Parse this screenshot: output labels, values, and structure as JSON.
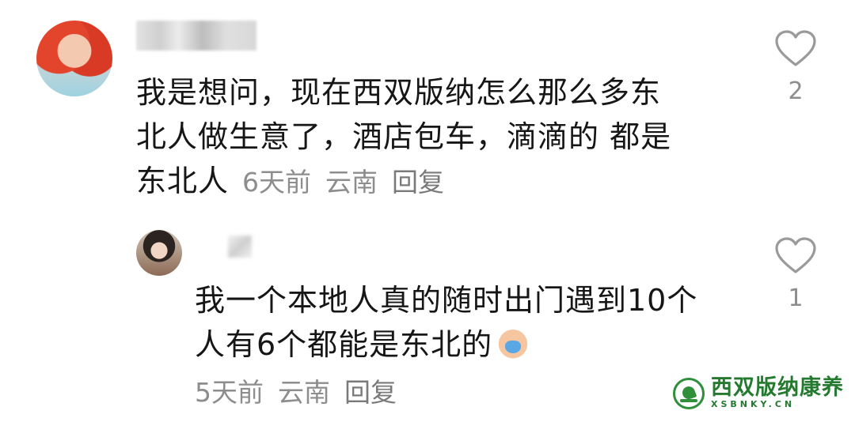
{
  "comments": [
    {
      "text": "我是想问，现在西双版纳怎么那么多东\n北人做生意了，酒店包车，滴滴的 都是\n东北人",
      "time": "6天前",
      "location": "云南",
      "reply_label": "回复",
      "likes": "2"
    },
    {
      "text": "我一个本地人真的随时出门遇到10个\n人有6个都能是东北的",
      "time": "5天前",
      "location": "云南",
      "reply_label": "回复",
      "likes": "1"
    }
  ],
  "watermark": {
    "title": "西双版纳康养",
    "subtitle": "XSBNKY.CN"
  },
  "colors": {
    "text": "#161616",
    "meta": "#8d8d8d",
    "brand": "#247a2f"
  },
  "icons": [
    "heart-icon",
    "crying-emoji-icon",
    "palm-tree-logo-icon"
  ]
}
